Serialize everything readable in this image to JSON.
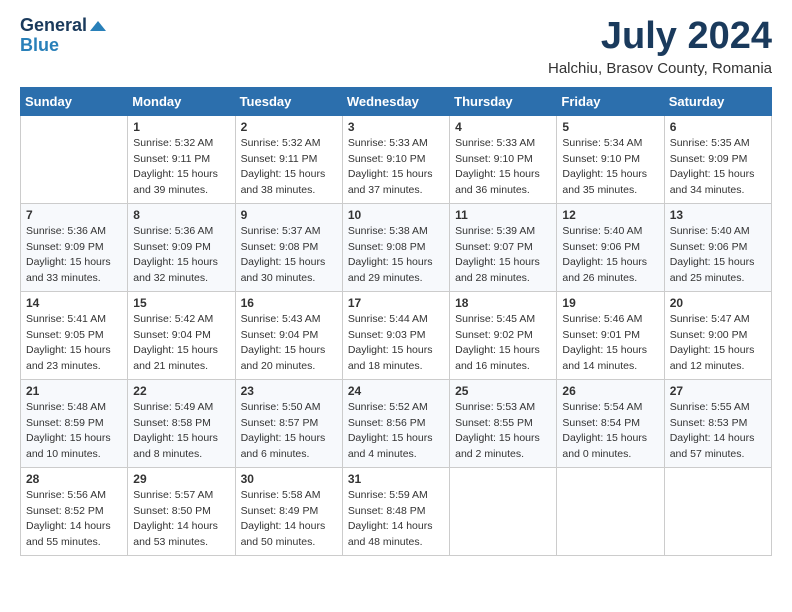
{
  "header": {
    "logo_line1": "General",
    "logo_line2": "Blue",
    "month": "July 2024",
    "location": "Halchiu, Brasov County, Romania"
  },
  "weekdays": [
    "Sunday",
    "Monday",
    "Tuesday",
    "Wednesday",
    "Thursday",
    "Friday",
    "Saturday"
  ],
  "weeks": [
    [
      {
        "day": "",
        "sunrise": "",
        "sunset": "",
        "daylight": ""
      },
      {
        "day": "1",
        "sunrise": "Sunrise: 5:32 AM",
        "sunset": "Sunset: 9:11 PM",
        "daylight": "Daylight: 15 hours and 39 minutes."
      },
      {
        "day": "2",
        "sunrise": "Sunrise: 5:32 AM",
        "sunset": "Sunset: 9:11 PM",
        "daylight": "Daylight: 15 hours and 38 minutes."
      },
      {
        "day": "3",
        "sunrise": "Sunrise: 5:33 AM",
        "sunset": "Sunset: 9:10 PM",
        "daylight": "Daylight: 15 hours and 37 minutes."
      },
      {
        "day": "4",
        "sunrise": "Sunrise: 5:33 AM",
        "sunset": "Sunset: 9:10 PM",
        "daylight": "Daylight: 15 hours and 36 minutes."
      },
      {
        "day": "5",
        "sunrise": "Sunrise: 5:34 AM",
        "sunset": "Sunset: 9:10 PM",
        "daylight": "Daylight: 15 hours and 35 minutes."
      },
      {
        "day": "6",
        "sunrise": "Sunrise: 5:35 AM",
        "sunset": "Sunset: 9:09 PM",
        "daylight": "Daylight: 15 hours and 34 minutes."
      }
    ],
    [
      {
        "day": "7",
        "sunrise": "Sunrise: 5:36 AM",
        "sunset": "Sunset: 9:09 PM",
        "daylight": "Daylight: 15 hours and 33 minutes."
      },
      {
        "day": "8",
        "sunrise": "Sunrise: 5:36 AM",
        "sunset": "Sunset: 9:09 PM",
        "daylight": "Daylight: 15 hours and 32 minutes."
      },
      {
        "day": "9",
        "sunrise": "Sunrise: 5:37 AM",
        "sunset": "Sunset: 9:08 PM",
        "daylight": "Daylight: 15 hours and 30 minutes."
      },
      {
        "day": "10",
        "sunrise": "Sunrise: 5:38 AM",
        "sunset": "Sunset: 9:08 PM",
        "daylight": "Daylight: 15 hours and 29 minutes."
      },
      {
        "day": "11",
        "sunrise": "Sunrise: 5:39 AM",
        "sunset": "Sunset: 9:07 PM",
        "daylight": "Daylight: 15 hours and 28 minutes."
      },
      {
        "day": "12",
        "sunrise": "Sunrise: 5:40 AM",
        "sunset": "Sunset: 9:06 PM",
        "daylight": "Daylight: 15 hours and 26 minutes."
      },
      {
        "day": "13",
        "sunrise": "Sunrise: 5:40 AM",
        "sunset": "Sunset: 9:06 PM",
        "daylight": "Daylight: 15 hours and 25 minutes."
      }
    ],
    [
      {
        "day": "14",
        "sunrise": "Sunrise: 5:41 AM",
        "sunset": "Sunset: 9:05 PM",
        "daylight": "Daylight: 15 hours and 23 minutes."
      },
      {
        "day": "15",
        "sunrise": "Sunrise: 5:42 AM",
        "sunset": "Sunset: 9:04 PM",
        "daylight": "Daylight: 15 hours and 21 minutes."
      },
      {
        "day": "16",
        "sunrise": "Sunrise: 5:43 AM",
        "sunset": "Sunset: 9:04 PM",
        "daylight": "Daylight: 15 hours and 20 minutes."
      },
      {
        "day": "17",
        "sunrise": "Sunrise: 5:44 AM",
        "sunset": "Sunset: 9:03 PM",
        "daylight": "Daylight: 15 hours and 18 minutes."
      },
      {
        "day": "18",
        "sunrise": "Sunrise: 5:45 AM",
        "sunset": "Sunset: 9:02 PM",
        "daylight": "Daylight: 15 hours and 16 minutes."
      },
      {
        "day": "19",
        "sunrise": "Sunrise: 5:46 AM",
        "sunset": "Sunset: 9:01 PM",
        "daylight": "Daylight: 15 hours and 14 minutes."
      },
      {
        "day": "20",
        "sunrise": "Sunrise: 5:47 AM",
        "sunset": "Sunset: 9:00 PM",
        "daylight": "Daylight: 15 hours and 12 minutes."
      }
    ],
    [
      {
        "day": "21",
        "sunrise": "Sunrise: 5:48 AM",
        "sunset": "Sunset: 8:59 PM",
        "daylight": "Daylight: 15 hours and 10 minutes."
      },
      {
        "day": "22",
        "sunrise": "Sunrise: 5:49 AM",
        "sunset": "Sunset: 8:58 PM",
        "daylight": "Daylight: 15 hours and 8 minutes."
      },
      {
        "day": "23",
        "sunrise": "Sunrise: 5:50 AM",
        "sunset": "Sunset: 8:57 PM",
        "daylight": "Daylight: 15 hours and 6 minutes."
      },
      {
        "day": "24",
        "sunrise": "Sunrise: 5:52 AM",
        "sunset": "Sunset: 8:56 PM",
        "daylight": "Daylight: 15 hours and 4 minutes."
      },
      {
        "day": "25",
        "sunrise": "Sunrise: 5:53 AM",
        "sunset": "Sunset: 8:55 PM",
        "daylight": "Daylight: 15 hours and 2 minutes."
      },
      {
        "day": "26",
        "sunrise": "Sunrise: 5:54 AM",
        "sunset": "Sunset: 8:54 PM",
        "daylight": "Daylight: 15 hours and 0 minutes."
      },
      {
        "day": "27",
        "sunrise": "Sunrise: 5:55 AM",
        "sunset": "Sunset: 8:53 PM",
        "daylight": "Daylight: 14 hours and 57 minutes."
      }
    ],
    [
      {
        "day": "28",
        "sunrise": "Sunrise: 5:56 AM",
        "sunset": "Sunset: 8:52 PM",
        "daylight": "Daylight: 14 hours and 55 minutes."
      },
      {
        "day": "29",
        "sunrise": "Sunrise: 5:57 AM",
        "sunset": "Sunset: 8:50 PM",
        "daylight": "Daylight: 14 hours and 53 minutes."
      },
      {
        "day": "30",
        "sunrise": "Sunrise: 5:58 AM",
        "sunset": "Sunset: 8:49 PM",
        "daylight": "Daylight: 14 hours and 50 minutes."
      },
      {
        "day": "31",
        "sunrise": "Sunrise: 5:59 AM",
        "sunset": "Sunset: 8:48 PM",
        "daylight": "Daylight: 14 hours and 48 minutes."
      },
      {
        "day": "",
        "sunrise": "",
        "sunset": "",
        "daylight": ""
      },
      {
        "day": "",
        "sunrise": "",
        "sunset": "",
        "daylight": ""
      },
      {
        "day": "",
        "sunrise": "",
        "sunset": "",
        "daylight": ""
      }
    ]
  ]
}
